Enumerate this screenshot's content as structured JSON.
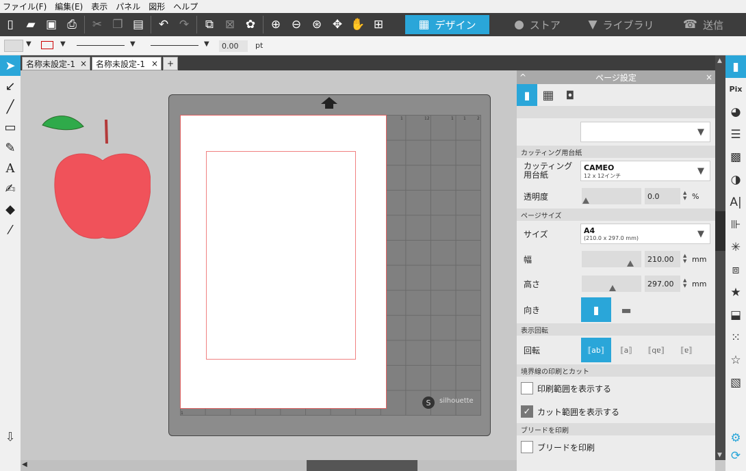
{
  "menu": [
    "ファイル(F)",
    "編集(E)",
    "表示",
    "パネル",
    "図形",
    "ヘルプ"
  ],
  "modes": {
    "design": "デザイン",
    "store": "ストア",
    "library": "ライブラリ",
    "send": "送信"
  },
  "propbar": {
    "line_width": "0.00",
    "unit": "pt"
  },
  "tabs": [
    {
      "label": "名称未設定-1",
      "close": "×"
    },
    {
      "label": "名称未設定-1",
      "close": "×"
    }
  ],
  "add_tab": "+",
  "mat": {
    "brand": "silhouette",
    "ruler_top": [
      "1",
      "12",
      "1",
      "1",
      "2"
    ],
    "ruler_bottom_left": "1"
  },
  "panel": {
    "title": "ページ設定",
    "collapse": "^",
    "close": "×",
    "cutting_mat_section": "カッティング用台紙",
    "cutting_mat_label": "カッティング用台紙",
    "cutting_mat_value": "CAMEO",
    "cutting_mat_sub": "12 x 12インチ",
    "transparency_label": "透明度",
    "transparency_value": "0.0",
    "transparency_unit": "%",
    "page_size_section": "ページサイズ",
    "size_label": "サイズ",
    "size_value": "A4",
    "size_sub": "(210.0 x 297.0 mm)",
    "width_label": "幅",
    "width_value": "210.00",
    "height_label": "高さ",
    "height_value": "297.00",
    "mm": "mm",
    "orientation_label": "向き",
    "rotate_section": "表示回転",
    "rotate_label": "回転",
    "border_section": "境界線の印刷とカット",
    "show_print_area": "印刷範囲を表示する",
    "show_cut_area": "カット範囲を表示する",
    "bleed_section": "ブリードを印刷",
    "print_bleed": "ブリードを印刷"
  },
  "colors": {
    "accent": "#2aa6d9",
    "apple": "#f0525a",
    "leaf": "#2faa4a"
  }
}
